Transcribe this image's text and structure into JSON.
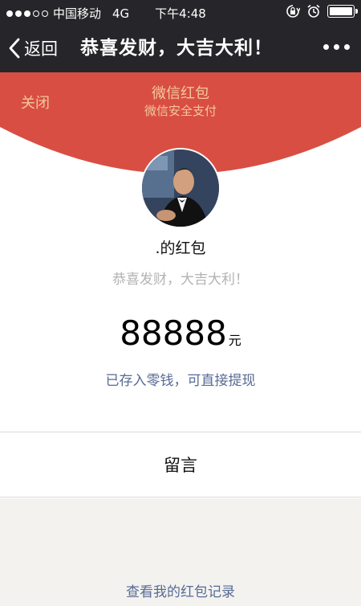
{
  "status_bar": {
    "carrier": "中国移动",
    "network": "4G",
    "time": "下午4:48",
    "signal_bars": 3,
    "signal_total": 5,
    "icons": [
      "rotation-lock-icon",
      "alarm-icon",
      "battery-icon"
    ]
  },
  "nav": {
    "back_label": "返回",
    "title": "恭喜发财，大吉大利！",
    "more_icon": "more-icon"
  },
  "hongbao": {
    "close_label": "关闭",
    "title": "微信红包",
    "subtitle": "微信安全支付",
    "sender": ".的红包",
    "wish": "恭喜发财，大吉大利！",
    "amount": "88888",
    "unit": "元",
    "saved_note": "已存入零钱，可直接提现"
  },
  "message_label": "留言",
  "records_label": "查看我的红包记录",
  "colors": {
    "red": "#d84e43",
    "gold": "#f2c89a",
    "link": "#576b95",
    "dark": "#26262a"
  }
}
